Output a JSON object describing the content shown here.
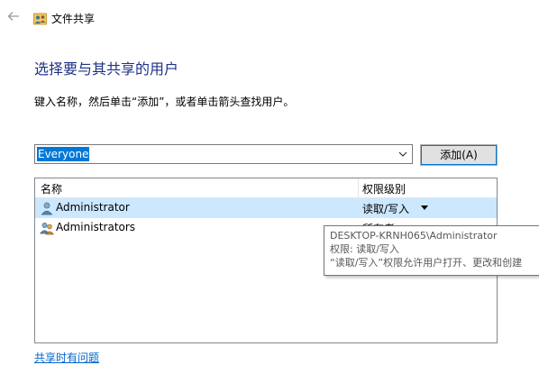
{
  "window": {
    "title": "文件共享"
  },
  "heading": "选择要与其共享的用户",
  "instruction": "键入名称，然后单击“添加”，或者单击箭头查找用户。",
  "user_input": {
    "value": "Everyone"
  },
  "add_button": {
    "label": "添加(A)"
  },
  "list": {
    "headers": {
      "name": "名称",
      "permission": "权限级别"
    },
    "rows": [
      {
        "name": "Administrator",
        "permission": "读取/写入",
        "selected": true
      },
      {
        "name": "Administrators",
        "permission": "所有者",
        "selected": false
      }
    ]
  },
  "tooltip": {
    "line1": "DESKTOP-KRNH065\\Administrator",
    "line2": "权限: 读取/写入",
    "line3": "“读取/写入”权限允许用户打开、更改和创建"
  },
  "help_link": "共享时有问题",
  "colors": {
    "accent": "#0078d7",
    "heading": "#1e3287",
    "selection": "#cce8ff",
    "link": "#0066cc"
  }
}
